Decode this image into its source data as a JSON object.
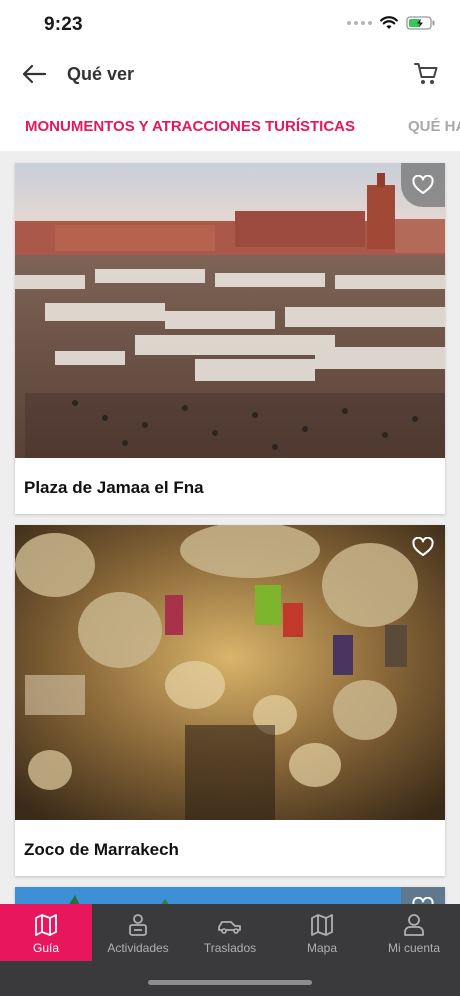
{
  "status_bar": {
    "time": "9:23"
  },
  "header": {
    "title": "Qué ver"
  },
  "tabs": [
    {
      "label": "MONUMENTOS Y ATRACCIONES TURÍSTICAS",
      "active": true
    },
    {
      "label": "QUÉ HA",
      "active": false
    }
  ],
  "cards": [
    {
      "title": "Plaza de Jamaa el Fna",
      "favorite_icon": "heart-outline-icon"
    },
    {
      "title": "Zoco de Marrakech",
      "favorite_icon": "heart-outline-icon"
    },
    {
      "title": "",
      "favorite_icon": "heart-outline-icon"
    }
  ],
  "bottom_nav": [
    {
      "label": "Guía",
      "icon": "map-book-icon",
      "active": true
    },
    {
      "label": "Actividades",
      "icon": "person-ticket-icon",
      "active": false
    },
    {
      "label": "Traslados",
      "icon": "car-icon",
      "active": false
    },
    {
      "label": "Mapa",
      "icon": "map-icon",
      "active": false
    },
    {
      "label": "Mi cuenta",
      "icon": "user-icon",
      "active": false
    }
  ],
  "colors": {
    "accent": "#e8175d",
    "nav_bg": "#3a3a3c",
    "inactive_tab": "#a8a8a8",
    "content_bg": "#eeeeee"
  }
}
